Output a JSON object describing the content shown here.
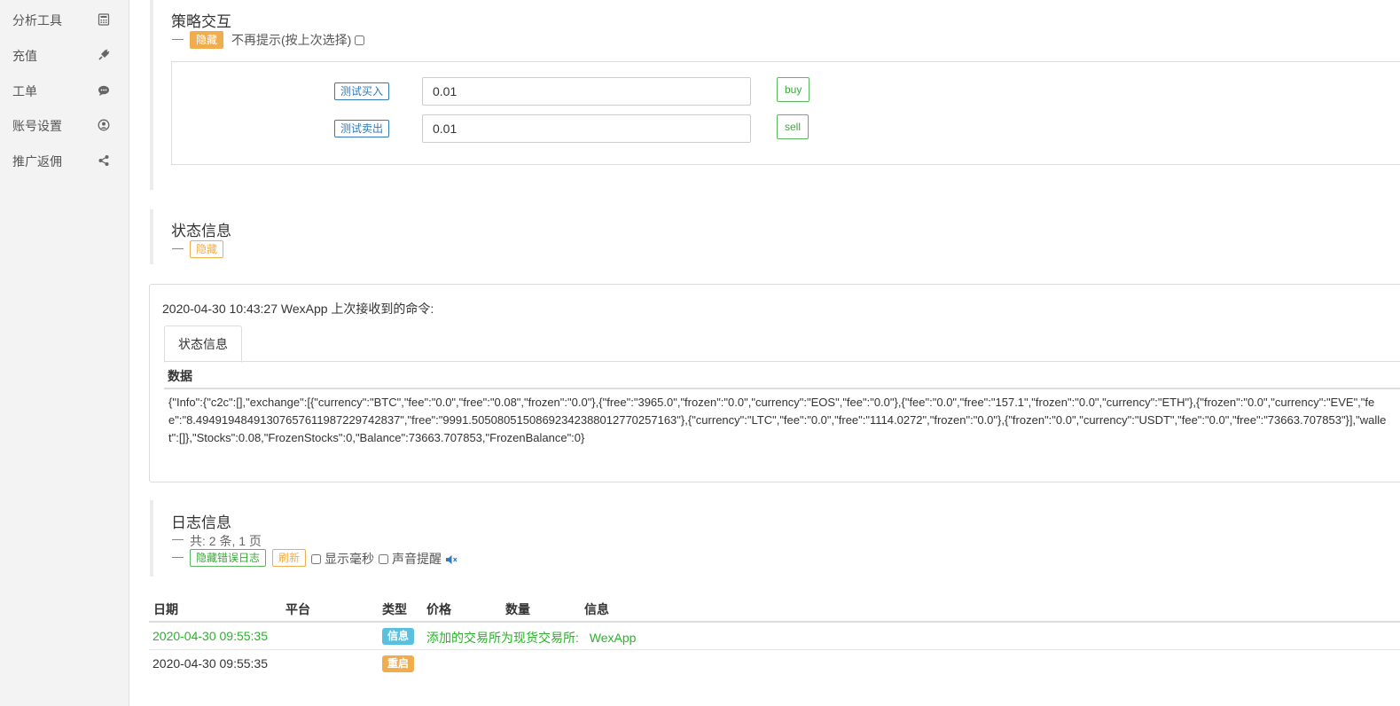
{
  "sidebar": {
    "items": [
      {
        "label": "分析工具",
        "icon": "calculator-icon"
      },
      {
        "label": "充值",
        "icon": "plug-icon"
      },
      {
        "label": "工单",
        "icon": "chat-icon"
      },
      {
        "label": "账号设置",
        "icon": "user-circle-icon"
      },
      {
        "label": "推广返佣",
        "icon": "share-icon"
      }
    ]
  },
  "strategy": {
    "title": "策略交互",
    "dash": "—",
    "hide_label": "隐藏",
    "no_prompt_label": "不再提示(按上次选择)",
    "rows": [
      {
        "label": "测试买入",
        "value": "0.01",
        "button": "buy"
      },
      {
        "label": "测试卖出",
        "value": "0.01",
        "button": "sell"
      }
    ]
  },
  "status": {
    "title": "状态信息",
    "dash": "—",
    "hide_label": "隐藏",
    "command_text": "2020-04-30 10:43:27 WexApp 上次接收到的命令:",
    "tab_label": "状态信息",
    "data_header": "数据",
    "json": "{\"Info\":{\"c2c\":[],\"exchange\":[{\"currency\":\"BTC\",\"fee\":\"0.0\",\"free\":\"0.08\",\"frozen\":\"0.0\"},{\"free\":\"3965.0\",\"frozen\":\"0.0\",\"currency\":\"EOS\",\"fee\":\"0.0\"},{\"fee\":\"0.0\",\"free\":\"157.1\",\"frozen\":\"0.0\",\"currency\":\"ETH\"},{\"frozen\":\"0.0\",\"currency\":\"EVE\",\"fee\":\"8.49491948491307657611987229742837\",\"free\":\"9991.50508051508692342388012770257163\"},{\"currency\":\"LTC\",\"fee\":\"0.0\",\"free\":\"1114.0272\",\"frozen\":\"0.0\"},{\"frozen\":\"0.0\",\"currency\":\"USDT\",\"fee\":\"0.0\",\"free\":\"73663.707853\"}],\"wallet\":[]},\"Stocks\":0.08,\"FrozenStocks\":0,\"Balance\":73663.707853,\"FrozenBalance\":0}"
  },
  "log": {
    "title": "日志信息",
    "dash": "—",
    "summary": "共: 2 条, 1 页",
    "hide_errors_label": "隐藏错误日志",
    "refresh_label": "刷新",
    "show_ms_label": "显示毫秒",
    "sound_label": "声音提醒",
    "columns": [
      "日期",
      "平台",
      "类型",
      "价格",
      "数量",
      "信息"
    ],
    "rows": [
      {
        "date": "2020-04-30 09:55:35",
        "type": "信息",
        "type_color": "#5bc0de",
        "info": "添加的交易所为现货交易所:",
        "info2": "WexApp"
      },
      {
        "date": "2020-04-30 09:55:35",
        "type": "重启",
        "type_color": "#f0ad4e",
        "info": "",
        "info2": ""
      }
    ]
  },
  "colors": {
    "accent_orange": "#f0ad4e",
    "accent_green": "#5cb85c",
    "accent_blue": "#337ab7",
    "info_blue": "#5bc0de"
  }
}
